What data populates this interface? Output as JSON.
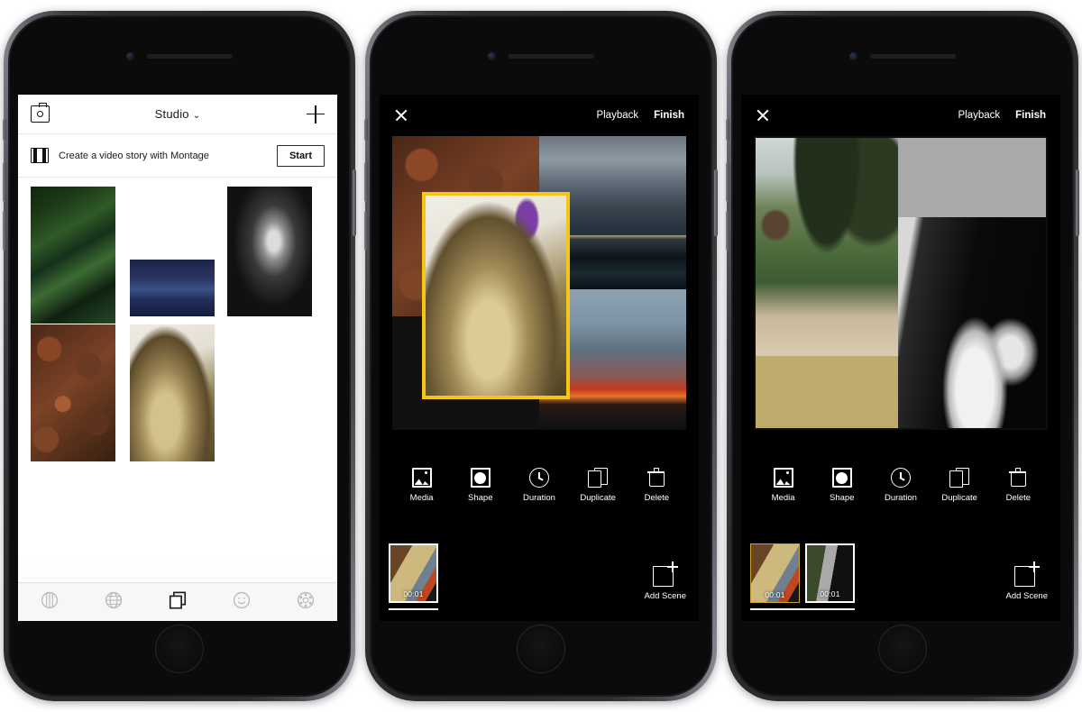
{
  "app": {
    "name": "Adobe Spark Post Studio",
    "accent_yellow": "#f5c518",
    "frame_color": "#2b2d31"
  },
  "phone1": {
    "header": {
      "folder_icon": "folder-camera-icon",
      "title": "Studio",
      "chevron": "⌄",
      "add_icon": "plus-icon"
    },
    "promo": {
      "icon": "film-strip-icon",
      "text": "Create a video story with Montage",
      "button_label": "Start"
    },
    "gallery": {
      "items": [
        {
          "name": "green-foliage",
          "alt": "Dense green leaves"
        },
        {
          "name": "blue-mountain",
          "alt": "Blue mountain at dusk"
        },
        {
          "name": "bw-portrait",
          "alt": "Black and white portrait with cap"
        },
        {
          "name": "brown-bark",
          "alt": "Brown bark mulch texture"
        },
        {
          "name": "cat-photo",
          "alt": "Fluffy cat on blue chair"
        }
      ]
    },
    "tabbar": {
      "items": [
        {
          "name": "tab-feed",
          "icon": "circle-columns-icon",
          "active": false
        },
        {
          "name": "tab-discover",
          "icon": "globe-icon",
          "active": false
        },
        {
          "name": "tab-studio",
          "icon": "layers-icon",
          "active": true
        },
        {
          "name": "tab-profile",
          "icon": "smiley-icon",
          "active": false
        },
        {
          "name": "tab-explore",
          "icon": "dotted-circle-icon",
          "active": false
        }
      ]
    }
  },
  "phone2": {
    "header": {
      "close_icon": "close-x-icon",
      "playback_label": "Playback",
      "finish_label": "Finish"
    },
    "canvas": {
      "selection_color": "#f5c518",
      "cells": [
        {
          "name": "brown-bark",
          "alt": "Brown bark mulch texture"
        },
        {
          "name": "cloudy-sea",
          "alt": "Cloudy sky over sea"
        },
        {
          "name": "dark-water",
          "alt": "Dark water at night"
        },
        {
          "name": "sunset-horizon",
          "alt": "Red orange sunset over water"
        },
        {
          "name": "cat-photo-selected",
          "alt": "Fluffy cat on blue chair",
          "selected": true
        }
      ]
    },
    "toolbar": {
      "items": [
        {
          "name": "media",
          "icon": "image-icon",
          "label": "Media"
        },
        {
          "name": "shape",
          "icon": "square-circle-icon",
          "label": "Shape"
        },
        {
          "name": "duration",
          "icon": "clock-icon",
          "label": "Duration"
        },
        {
          "name": "duplicate",
          "icon": "copy-icon",
          "label": "Duplicate"
        },
        {
          "name": "delete",
          "icon": "trash-icon",
          "label": "Delete"
        }
      ]
    },
    "timeline": {
      "scenes": [
        {
          "name": "scene-1",
          "time": "00:01",
          "selected": true
        }
      ],
      "add_scene": {
        "icon": "add-square-plus-icon",
        "label": "Add Scene"
      }
    }
  },
  "phone3": {
    "header": {
      "close_icon": "close-x-icon",
      "playback_label": "Playback",
      "finish_label": "Finish"
    },
    "canvas": {
      "cells": [
        {
          "name": "forest-overlook",
          "alt": "Pine tree overlook above forest"
        },
        {
          "name": "khaki-block",
          "alt": "Solid khaki color block",
          "color": "#bfab6c"
        },
        {
          "name": "gray-block",
          "alt": "Solid gray color block",
          "color": "#a9a9a9"
        },
        {
          "name": "hummingbird",
          "alt": "Hummingbird at white birdbath on black"
        }
      ]
    },
    "toolbar": {
      "items": [
        {
          "name": "media",
          "icon": "image-icon",
          "label": "Media"
        },
        {
          "name": "shape",
          "icon": "square-circle-icon",
          "label": "Shape"
        },
        {
          "name": "duration",
          "icon": "clock-icon",
          "label": "Duration"
        },
        {
          "name": "duplicate",
          "icon": "copy-icon",
          "label": "Duplicate"
        },
        {
          "name": "delete",
          "icon": "trash-icon",
          "label": "Delete"
        }
      ]
    },
    "timeline": {
      "scenes": [
        {
          "name": "scene-1",
          "time": "00:01",
          "selected": false
        },
        {
          "name": "scene-2",
          "time": "00:01",
          "selected": true
        }
      ],
      "add_scene": {
        "icon": "add-square-plus-icon",
        "label": "Add Scene"
      }
    }
  }
}
